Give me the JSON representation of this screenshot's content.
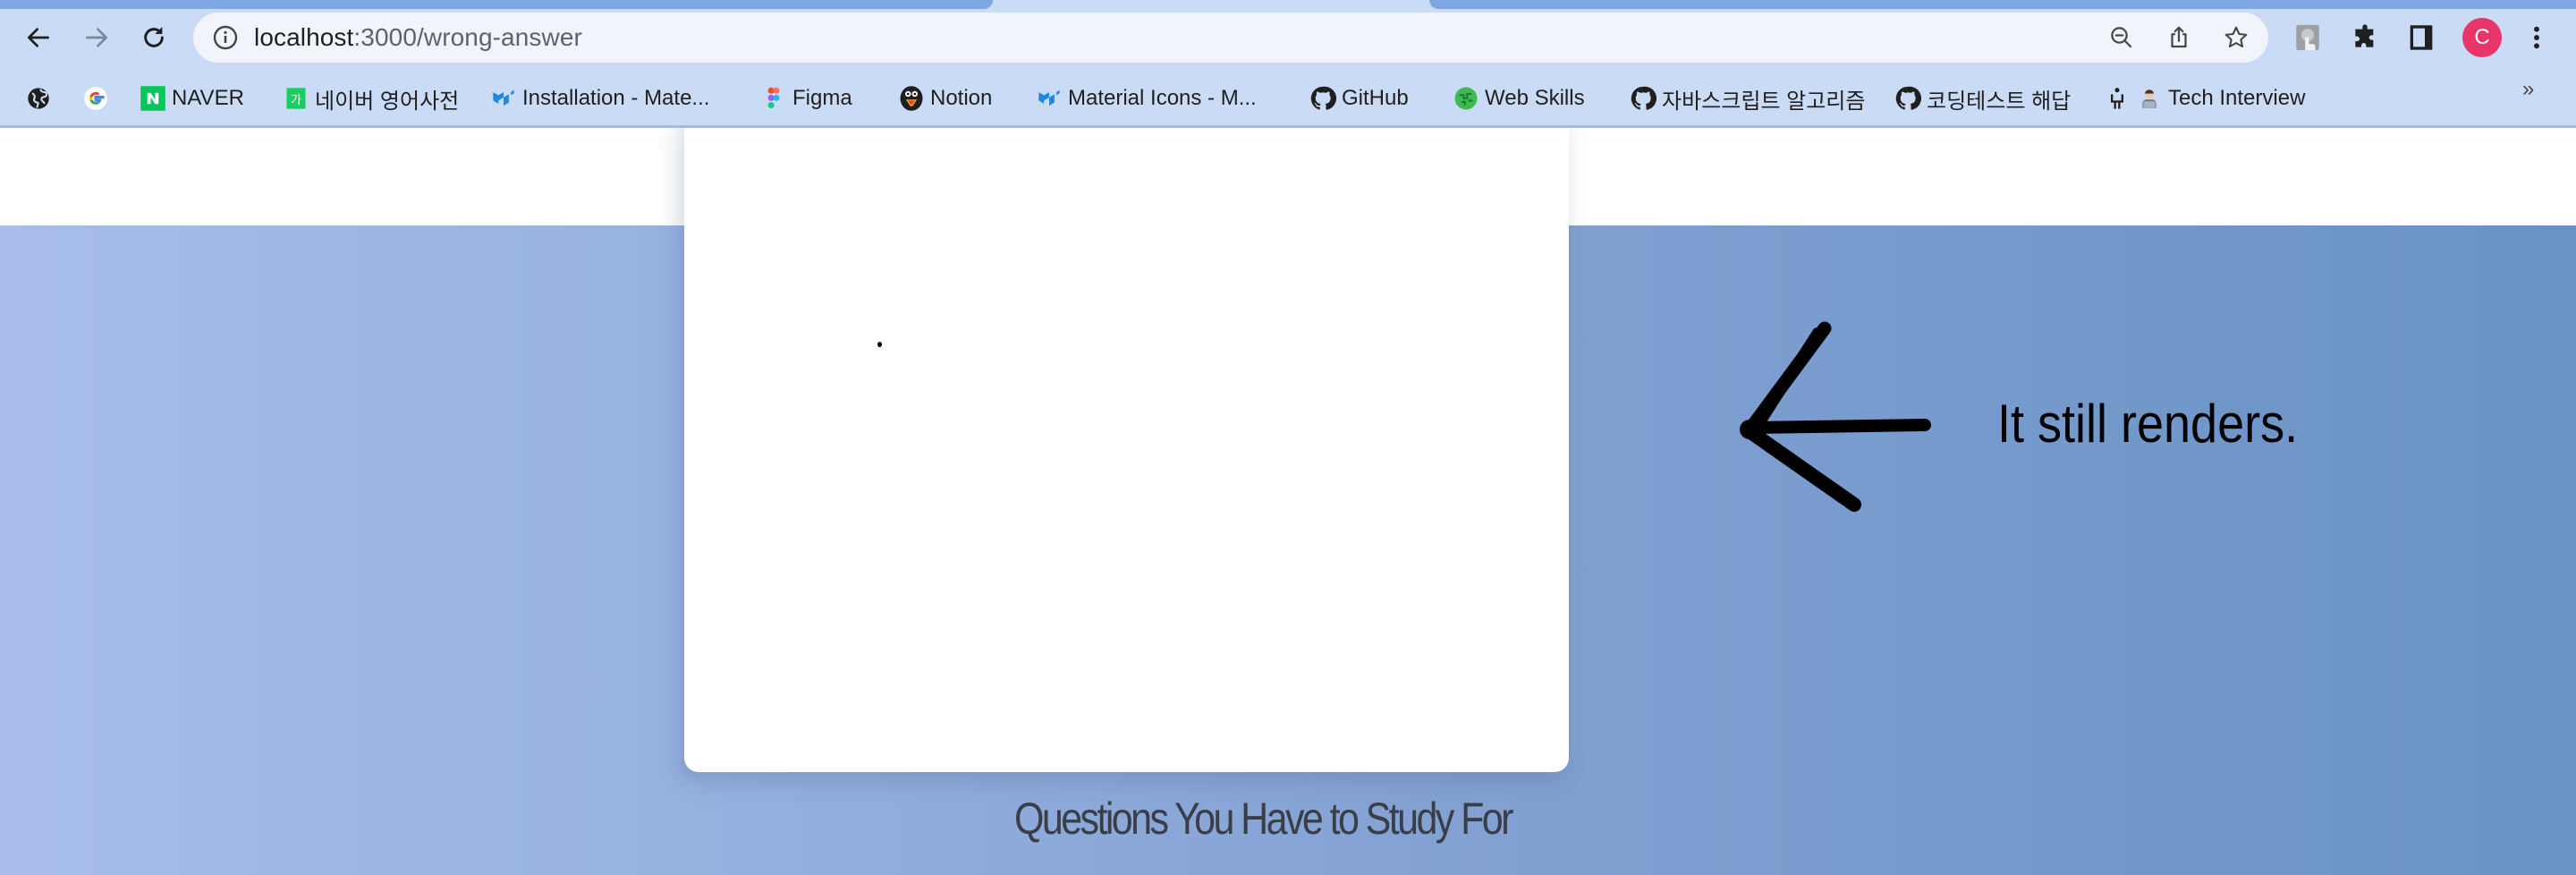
{
  "browser": {
    "url_host": "localhost",
    "url_rest": ":3000/wrong-answer",
    "nav": {
      "back_icon": "arrow-left-icon",
      "forward_icon": "arrow-right-icon",
      "reload_icon": "reload-icon"
    },
    "omnibox_icons": [
      "info-icon",
      "zoom-out-icon",
      "share-icon",
      "star-icon"
    ],
    "toolbar_icons": [
      "extension-thumb-icon",
      "puzzle-icon",
      "side-panel-icon",
      "profile-avatar",
      "kebab-menu-icon"
    ],
    "profile_initial": "C",
    "profile_color": "#e8366a",
    "bookmarks": [
      {
        "label": "",
        "icon": "globe-icon"
      },
      {
        "label": "",
        "icon": "google-icon"
      },
      {
        "label": "NAVER",
        "icon": "naver-icon"
      },
      {
        "label": "네이버 영어사전",
        "icon": "naver-dictionary-icon"
      },
      {
        "label": "Installation - Mate...",
        "icon": "mui-icon"
      },
      {
        "label": "Figma",
        "icon": "figma-icon"
      },
      {
        "label": "Notion",
        "icon": "notion-penguin-icon"
      },
      {
        "label": "Material Icons - M...",
        "icon": "mui-icon"
      },
      {
        "label": "GitHub",
        "icon": "github-icon"
      },
      {
        "label": "Web Skills",
        "icon": "web-skills-icon"
      },
      {
        "label": "자바스크립트 알고리즘",
        "icon": "github-icon"
      },
      {
        "label": "코딩테스트 해답",
        "icon": "github-icon"
      },
      {
        "label": "",
        "icon": "person-desk-icon"
      },
      {
        "label": "Tech Interview",
        "icon": "technologist-emoji-icon"
      }
    ],
    "bookmarks_overflow": "»"
  },
  "page": {
    "annotation_text": "It still renders.",
    "section_title": "Questions You Have to Study For",
    "colors": {
      "gradient_start": "#a8bdea",
      "gradient_end": "#6a92c5",
      "title_color": "#3a3e47"
    }
  }
}
